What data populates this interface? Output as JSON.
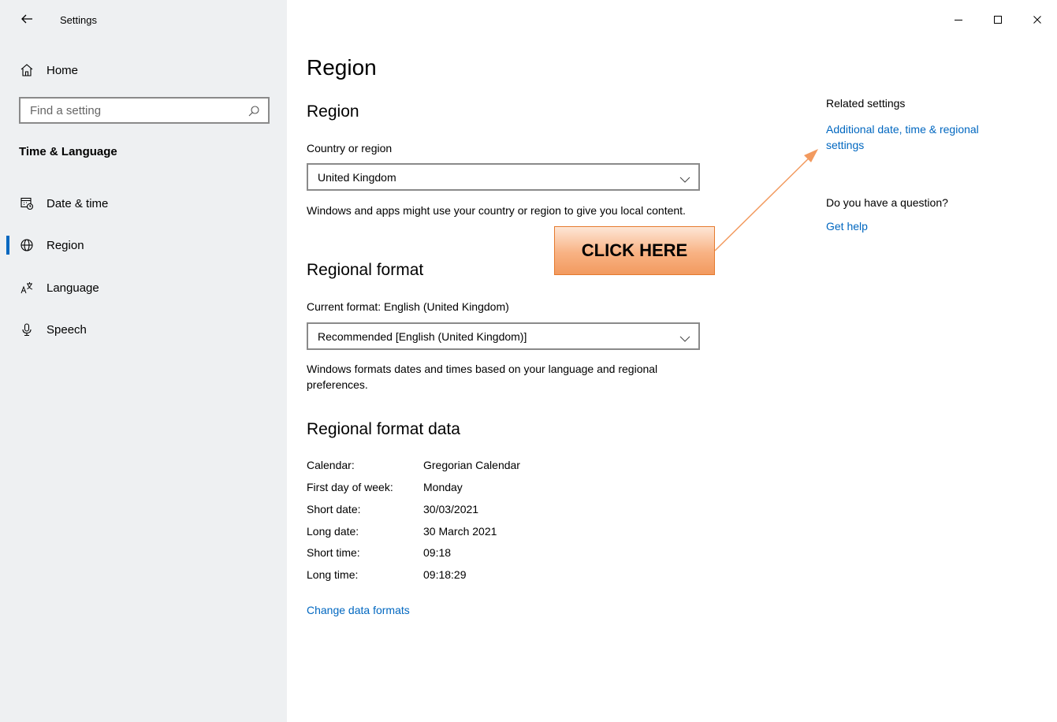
{
  "titlebar": {
    "title": "Settings",
    "controls": [
      "minimize-icon",
      "maximize-icon",
      "close-icon"
    ]
  },
  "sidebar": {
    "home_label": "Home",
    "search_placeholder": "Find a setting",
    "section_title": "Time & Language",
    "items": [
      {
        "label": "Date & time",
        "icon": "calendar-clock-icon",
        "active": false
      },
      {
        "label": "Region",
        "icon": "globe-icon",
        "active": true
      },
      {
        "label": "Language",
        "icon": "language-icon",
        "active": false
      },
      {
        "label": "Speech",
        "icon": "microphone-icon",
        "active": false
      }
    ],
    "accent_color": "#0067c0"
  },
  "main": {
    "page_title": "Region",
    "region_heading": "Region",
    "country_label": "Country or region",
    "country_value": "United Kingdom",
    "country_desc": "Windows and apps might use your country or region to give you local content.",
    "format_heading": "Regional format",
    "current_format_label": "Current format: English (United Kingdom)",
    "format_value": "Recommended [English (United Kingdom)]",
    "format_desc": "Windows formats dates and times based on your language and regional preferences.",
    "format_data_heading": "Regional format data",
    "format_data": [
      {
        "key": "Calendar:",
        "value": "Gregorian Calendar"
      },
      {
        "key": "First day of week:",
        "value": "Monday"
      },
      {
        "key": "Short date:",
        "value": "30/03/2021"
      },
      {
        "key": "Long date:",
        "value": "30 March 2021"
      },
      {
        "key": "Short time:",
        "value": "09:18"
      },
      {
        "key": "Long time:",
        "value": "09:18:29"
      }
    ],
    "change_formats_link": "Change data formats"
  },
  "related": {
    "heading": "Related settings",
    "link_line1": "Additional date, time & regional",
    "link_line2": "settings",
    "question": "Do you have a question?",
    "help_link": "Get help"
  },
  "annotation": {
    "callout_text": "CLICK HERE",
    "color": "#f29a5f"
  }
}
